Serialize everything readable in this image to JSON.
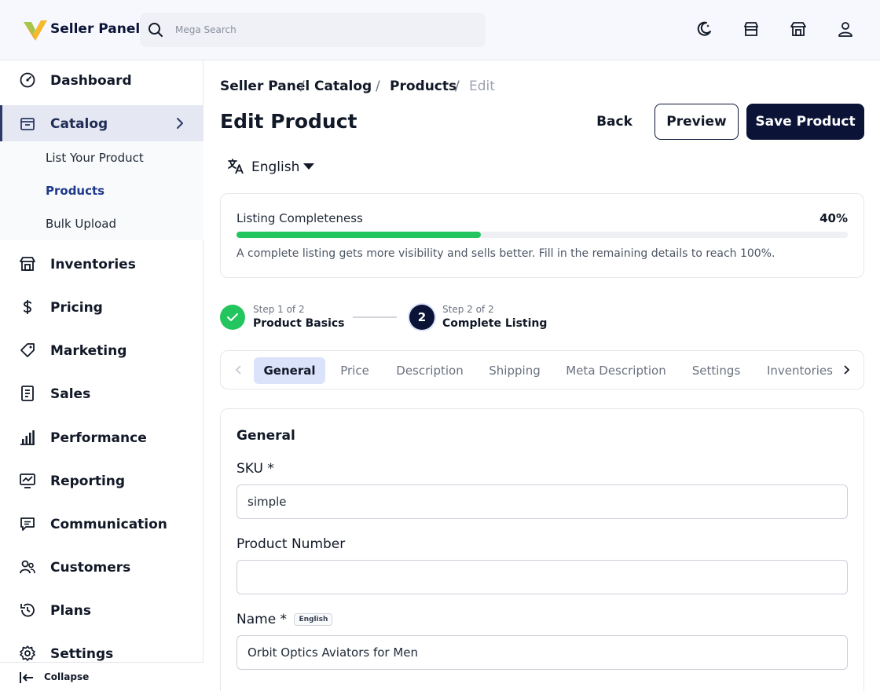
{
  "header": {
    "brand": "Seller Panel",
    "search_placeholder": "Mega Search",
    "icons": [
      "moon-icon",
      "store-icon",
      "shop-icon",
      "user-icon"
    ]
  },
  "sidebar": {
    "items": [
      {
        "label": "Dashboard",
        "icon": "dashboard-icon"
      },
      {
        "label": "Catalog",
        "icon": "catalog-icon",
        "active": true
      },
      {
        "label": "Inventories",
        "icon": "warehouse-icon"
      },
      {
        "label": "Pricing",
        "icon": "dollar-icon"
      },
      {
        "label": "Marketing",
        "icon": "tag-icon"
      },
      {
        "label": "Sales",
        "icon": "receipt-icon"
      },
      {
        "label": "Performance",
        "icon": "bar-chart-icon"
      },
      {
        "label": "Reporting",
        "icon": "report-icon"
      },
      {
        "label": "Communication",
        "icon": "message-icon"
      },
      {
        "label": "Customers",
        "icon": "customers-icon"
      },
      {
        "label": "Plans",
        "icon": "history-icon"
      },
      {
        "label": "Settings",
        "icon": "gear-icon"
      }
    ],
    "catalog_sub": [
      "List Your Product",
      "Products",
      "Bulk Upload"
    ],
    "collapse_label": "Collapse"
  },
  "breadcrumb": {
    "items": [
      "Seller Panel",
      "Catalog",
      "Products"
    ],
    "separator": "/",
    "current": "Edit"
  },
  "page": {
    "title": "Edit Product",
    "back_label": "Back",
    "preview_label": "Preview",
    "save_label": "Save Product",
    "language": "English"
  },
  "completeness": {
    "label": "Listing Completeness",
    "percent_label": "40%",
    "percent": 40,
    "note": "A complete listing gets more visibility and sells better. Fill in the remaining details to reach 100%."
  },
  "steps": [
    {
      "small": "Step 1 of 2",
      "title": "Product Basics",
      "state": "done"
    },
    {
      "small": "Step 2 of 2",
      "title": "Complete Listing",
      "state": "current",
      "number": "2"
    }
  ],
  "tabs": [
    "General",
    "Price",
    "Description",
    "Shipping",
    "Meta Description",
    "Settings",
    "Inventories"
  ],
  "form": {
    "section_title": "General",
    "sku_label": "SKU *",
    "sku_value": "simple",
    "product_number_label": "Product Number",
    "product_number_value": "",
    "name_label": "Name *",
    "name_badge": "English",
    "name_value": "Orbit Optics Aviators for Men"
  },
  "colors": {
    "primary": "#0b1437",
    "progress": "#22c55e",
    "active_tab": "#dbe3fb",
    "active_nav": "#e5e8f2",
    "logo_yellow": "#f5b82e",
    "logo_green": "#a3c64b"
  }
}
